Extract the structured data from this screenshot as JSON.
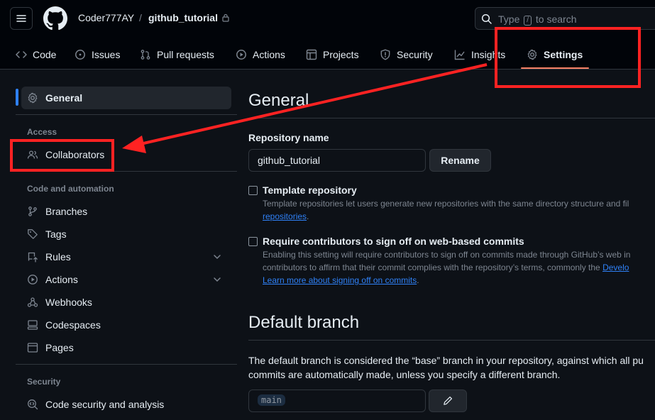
{
  "header": {
    "owner": "Coder777AY",
    "separator": "/",
    "repo": "github_tutorial",
    "search_prefix": "Type",
    "search_key": "/",
    "search_suffix": "to search"
  },
  "tabs": [
    {
      "label": "Code",
      "icon": "code-icon"
    },
    {
      "label": "Issues",
      "icon": "issue-icon"
    },
    {
      "label": "Pull requests",
      "icon": "pull-request-icon"
    },
    {
      "label": "Actions",
      "icon": "play-icon"
    },
    {
      "label": "Projects",
      "icon": "table-icon"
    },
    {
      "label": "Security",
      "icon": "shield-icon"
    },
    {
      "label": "Insights",
      "icon": "graph-icon"
    },
    {
      "label": "Settings",
      "icon": "gear-icon",
      "active": true
    }
  ],
  "sidebar": {
    "general": "General",
    "access_heading": "Access",
    "collaborators": "Collaborators",
    "code_heading": "Code and automation",
    "branches": "Branches",
    "tags": "Tags",
    "rules": "Rules",
    "actions": "Actions",
    "webhooks": "Webhooks",
    "codespaces": "Codespaces",
    "pages": "Pages",
    "security_heading": "Security",
    "code_security": "Code security and analysis"
  },
  "main": {
    "title": "General",
    "repo_name_label": "Repository name",
    "repo_name_value": "github_tutorial",
    "rename_button": "Rename",
    "template_title": "Template repository",
    "template_note_1": "Template repositories let users generate new repositories with the same directory structure and fil",
    "template_note_link": "repositories",
    "template_note_end": ".",
    "signoff_title": "Require contributors to sign off on web-based commits",
    "signoff_note_1": "Enabling this setting will require contributors to sign off on commits made through GitHub’s web in",
    "signoff_note_2": "contributors to affirm that their commit complies with the repository’s terms, commonly the ",
    "signoff_note_2_link": "Develo",
    "signoff_link": "Learn more about signing off on commits",
    "signoff_link_end": ".",
    "default_branch_title": "Default branch",
    "default_branch_line_1": "The default branch is considered the “base” branch in your repository, against which all pu",
    "default_branch_line_2": "commits are automatically made, unless you specify a different branch.",
    "branch_value": "main"
  },
  "colors": {
    "annotation": "#ff2222",
    "accent": "#2f81f7",
    "tab_underline": "#f78166"
  }
}
